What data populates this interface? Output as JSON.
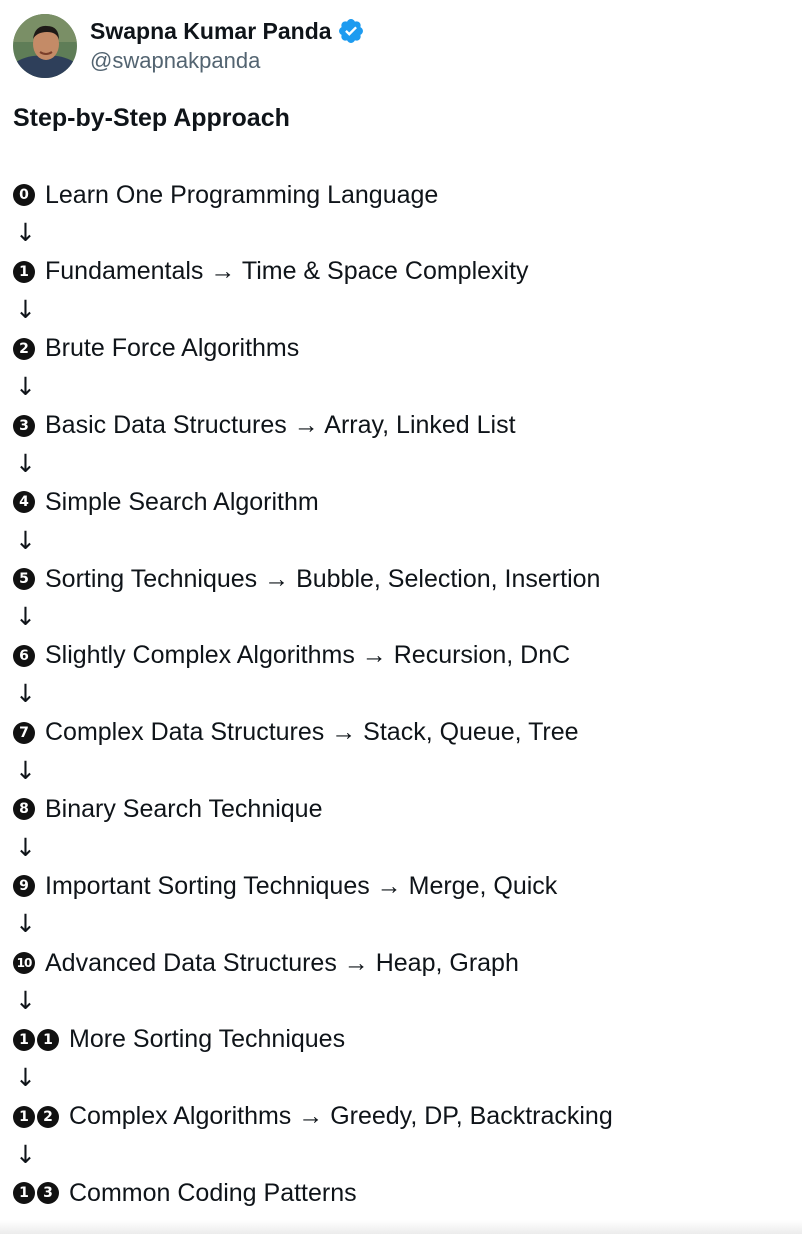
{
  "author": {
    "display_name": "Swapna Kumar Panda",
    "handle": "@swapnakpanda",
    "verified": true,
    "avatar_icon": "profile-photo",
    "verified_icon": "verified-badge-icon",
    "verified_color": "#1d9bf0"
  },
  "tweet": {
    "heading": "Step-by-Step Approach",
    "arrow_glyph": "↓",
    "steps": [
      {
        "badge": [
          "0"
        ],
        "text": "Learn One Programming Language"
      },
      {
        "badge": [
          "1"
        ],
        "text": "Fundamentals → Time & Space Complexity"
      },
      {
        "badge": [
          "2"
        ],
        "text": "Brute Force Algorithms"
      },
      {
        "badge": [
          "3"
        ],
        "text": "Basic Data Structures → Array, Linked List"
      },
      {
        "badge": [
          "4"
        ],
        "text": "Simple Search Algorithm"
      },
      {
        "badge": [
          "5"
        ],
        "text": "Sorting Techniques → Bubble, Selection, Insertion"
      },
      {
        "badge": [
          "6"
        ],
        "text": "Slightly Complex Algorithms → Recursion, DnC"
      },
      {
        "badge": [
          "7"
        ],
        "text": "Complex Data Structures → Stack, Queue, Tree"
      },
      {
        "badge": [
          "8"
        ],
        "text": "Binary Search Technique"
      },
      {
        "badge": [
          "9"
        ],
        "text": "Important Sorting Techniques → Merge, Quick"
      },
      {
        "badge": [
          "10"
        ],
        "text": "Advanced Data Structures → Heap, Graph"
      },
      {
        "badge": [
          "1",
          "1"
        ],
        "text": "More Sorting Techniques"
      },
      {
        "badge": [
          "1",
          "2"
        ],
        "text": "Complex Algorithms → Greedy, DP, Backtracking"
      },
      {
        "badge": [
          "1",
          "3"
        ],
        "text": "Common Coding Patterns"
      }
    ]
  }
}
